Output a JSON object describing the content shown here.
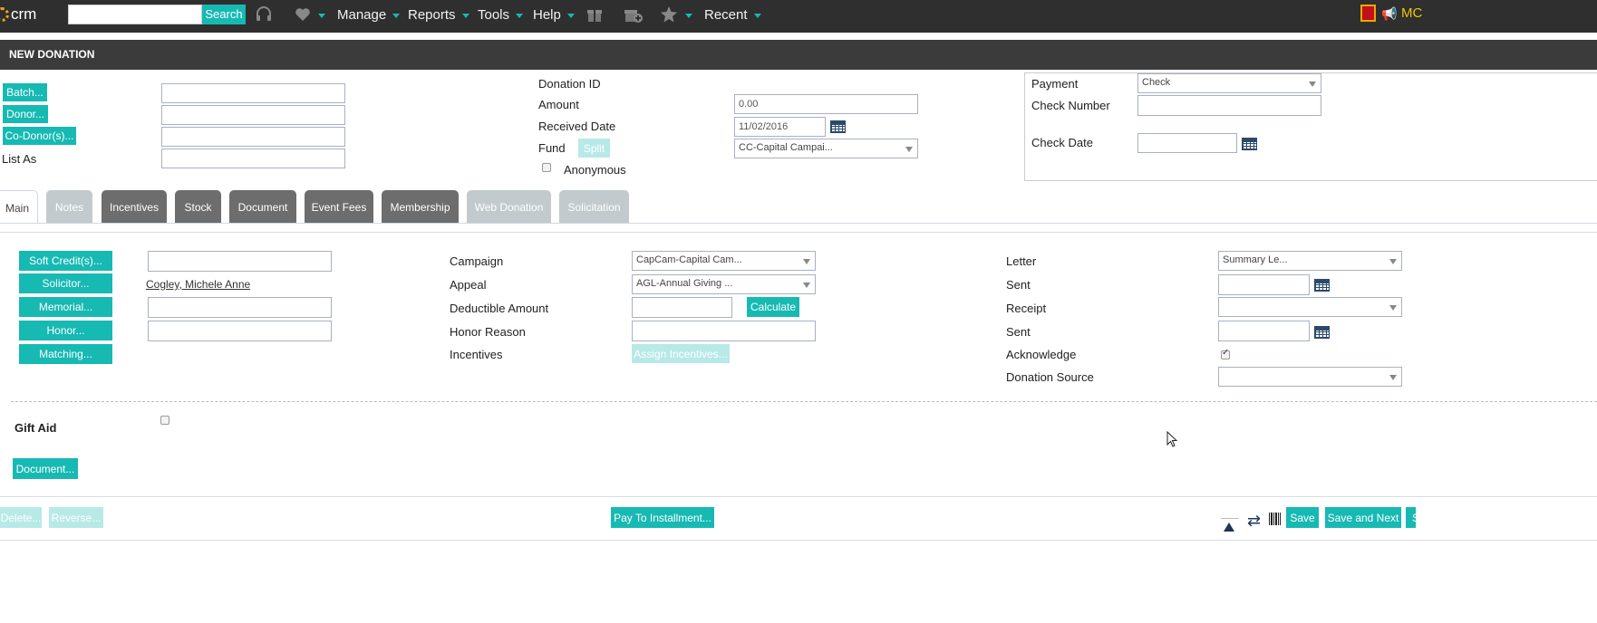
{
  "nav": {
    "logo_text": "crm",
    "search_button": "Search",
    "search_value": "",
    "menus": [
      "Manage",
      "Reports",
      "Tools",
      "Help",
      "Recent"
    ],
    "icons": [
      "headset-icon",
      "heart-icon",
      "gift-icon",
      "gift-add-icon",
      "star-icon",
      "notification-icon",
      "megaphone-icon"
    ],
    "user_initials": "MC",
    "accent_color": "#17b9b3"
  },
  "page_title": "NEW DONATION",
  "header_form": {
    "batch_button": "Batch...",
    "donor_button": "Donor...",
    "codonor_button": "Co-Donor(s)...",
    "list_as_label": "List As",
    "donation_id_label": "Donation ID",
    "amount_label": "Amount",
    "amount_value": "0.00",
    "received_date_label": "Received Date",
    "received_date_value": "11/02/2016",
    "fund_label": "Fund",
    "split_button": "Split",
    "fund_value": "CC-Capital Campai...",
    "anonymous_label": "Anonymous"
  },
  "payment": {
    "payment_label": "Payment",
    "payment_value": "Check",
    "check_number_label": "Check Number",
    "check_date_label": "Check Date"
  },
  "tabs": [
    {
      "label": "Main",
      "state": "active"
    },
    {
      "label": "Notes",
      "state": "disabled"
    },
    {
      "label": "Incentives",
      "state": "normal"
    },
    {
      "label": "Stock",
      "state": "normal"
    },
    {
      "label": "Document",
      "state": "normal"
    },
    {
      "label": "Event Fees",
      "state": "normal"
    },
    {
      "label": "Membership",
      "state": "normal"
    },
    {
      "label": "Web Donation",
      "state": "disabled"
    },
    {
      "label": "Solicitation",
      "state": "disabled"
    }
  ],
  "main": {
    "soft_credits_button": "Soft Credit(s)...",
    "solicitor_button": "Solicitor...",
    "solicitor_value": "Cogley, Michele Anne",
    "memorial_button": "Memorial...",
    "honor_button": "Honor...",
    "matching_button": "Matching...",
    "campaign_label": "Campaign",
    "campaign_value": "CapCam-Capital Cam...",
    "appeal_label": "Appeal",
    "appeal_value": "AGL-Annual Giving ...",
    "deductible_label": "Deductible Amount",
    "calculate_button": "Calculate",
    "honor_reason_label": "Honor Reason",
    "incentives_label": "Incentives",
    "assign_incentives_button": "Assign Incentives...",
    "letter_label": "Letter",
    "letter_value": "Summary Le...",
    "sent_label_1": "Sent",
    "receipt_label": "Receipt",
    "sent_label_2": "Sent",
    "acknowledge_label": "Acknowledge",
    "acknowledge_checked": true,
    "donation_source_label": "Donation Source",
    "gift_aid_label": "Gift Aid",
    "document_button": "Document..."
  },
  "footer": {
    "delete_button": "Delete...",
    "reverse_button": "Reverse...",
    "pay_installment_button": "Pay To Installment...",
    "save_button": "Save",
    "save_next_button": "Save and Next",
    "save_close_button_fragment": "Sa"
  }
}
